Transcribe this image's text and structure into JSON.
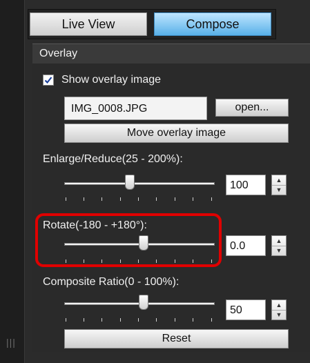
{
  "tabs": {
    "live_view": "Live View",
    "compose": "Compose"
  },
  "overlay": {
    "title": "Overlay",
    "show_overlay_label": "Show overlay image",
    "show_overlay_checked": true,
    "file_name": "IMG_0008.JPG",
    "open_button": "open...",
    "move_button": "Move overlay image"
  },
  "enlarge": {
    "label": "Enlarge/Reduce(25 - 200%):",
    "value": "100",
    "slider_fraction": 0.4
  },
  "rotate": {
    "label": "Rotate(-180 - +180°):",
    "value": "0.0",
    "slider_fraction": 0.5
  },
  "composite": {
    "label": "Composite Ratio(0 - 100%):",
    "value": "50",
    "slider_fraction": 0.5
  },
  "reset_button": "Reset",
  "colors": {
    "accent_tab": "#58b0e8",
    "highlight": "#e00000",
    "panel_bg": "#2a2a2a"
  }
}
